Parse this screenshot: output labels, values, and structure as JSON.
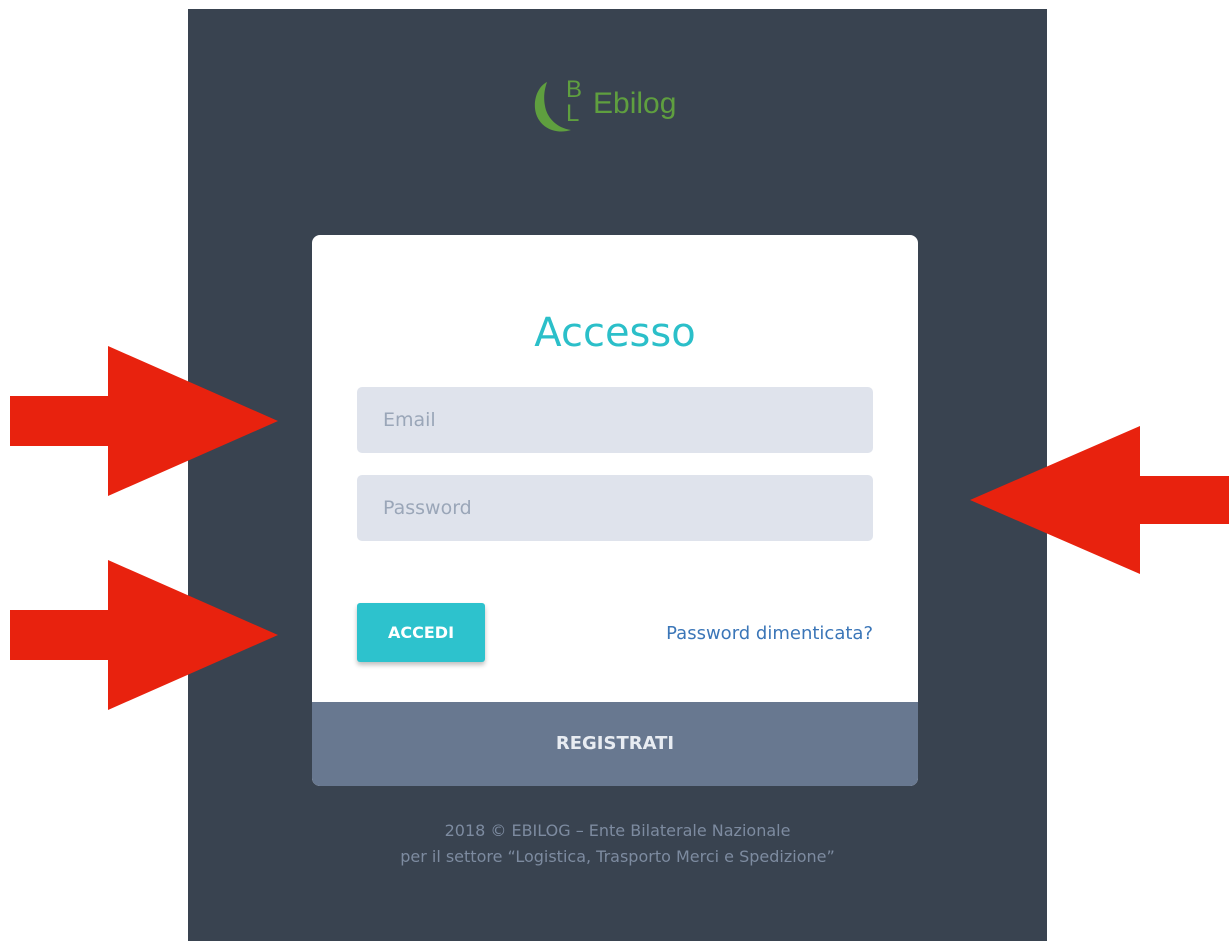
{
  "brand": {
    "logo_letter_top": "B",
    "logo_letter_bottom": "L",
    "name": "Ebilog",
    "color": "#5f9f3f"
  },
  "login": {
    "title": "Accesso",
    "email_placeholder": "Email",
    "password_placeholder": "Password",
    "submit_label": "ACCEDI",
    "forgot_label": "Password dimenticata?",
    "register_label": "REGISTRATI"
  },
  "footer": {
    "line1": "2018 © EBILOG – Ente Bilaterale Nazionale",
    "line2": "per il settore “Logistica, Trasporto Merci e Spedizione”"
  },
  "colors": {
    "panel_bg": "#394350",
    "accent": "#2dc2cd",
    "register_bg": "#687890",
    "annotation_arrow": "#e8220e"
  }
}
